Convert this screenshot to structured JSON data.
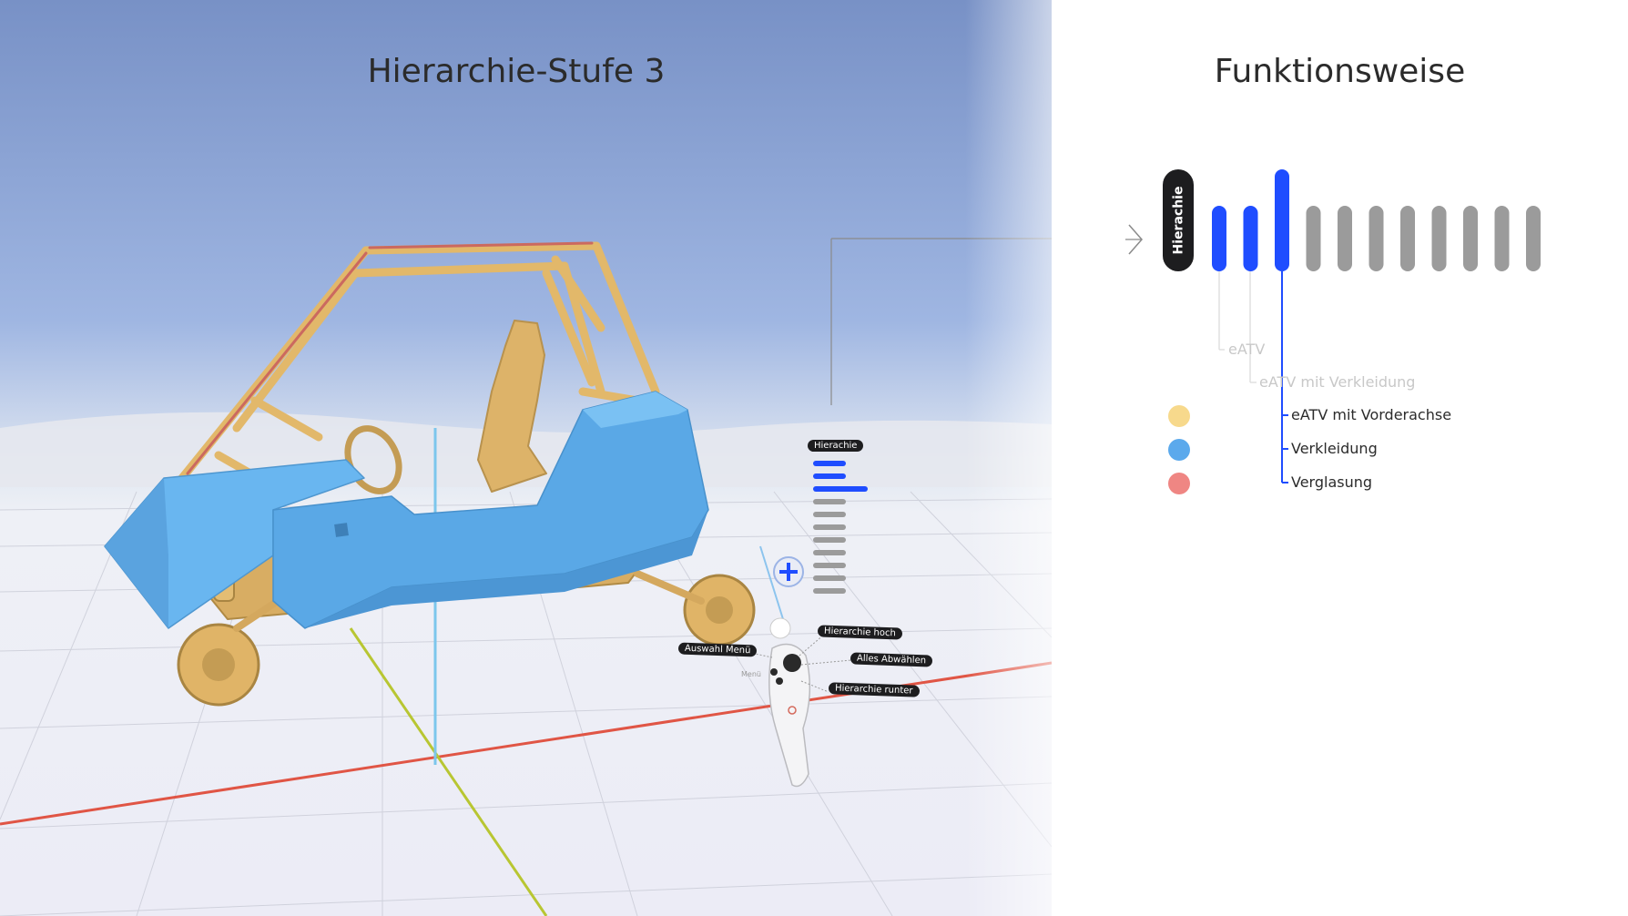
{
  "scene": {
    "title": "Hierarchie-Stufe 3"
  },
  "panel": {
    "title": "Funktionsweise",
    "hierarchy_pill_label": "Hierachie",
    "levels": [
      {
        "level": 1,
        "active": true
      },
      {
        "level": 2,
        "active": true
      },
      {
        "level": 3,
        "active": true,
        "current": true
      },
      {
        "level": 4,
        "active": false
      },
      {
        "level": 5,
        "active": false
      },
      {
        "level": 6,
        "active": false
      },
      {
        "level": 7,
        "active": false
      },
      {
        "level": 8,
        "active": false
      },
      {
        "level": 9,
        "active": false
      },
      {
        "level": 10,
        "active": false
      },
      {
        "level": 11,
        "active": false
      }
    ],
    "tree": [
      {
        "label": "eATV",
        "depth": 1,
        "dimmed": true
      },
      {
        "label": "eATV mit Verkleidung",
        "depth": 2,
        "dimmed": true
      },
      {
        "label": "eATV mit Vorderachse",
        "depth": 3,
        "dimmed": false,
        "color": "#f7d98c"
      },
      {
        "label": "Verkleidung",
        "depth": 3,
        "dimmed": false,
        "color": "#5ba9ec"
      },
      {
        "label": "Verglasung",
        "depth": 3,
        "dimmed": false,
        "color": "#ef8683"
      }
    ]
  },
  "vr_menu": {
    "hierarchy_label": "Hierachie",
    "controller_labels": {
      "hierarchy_up": "Hierarchie hoch",
      "deselect_all": "Alles Abwählen",
      "hierarchy_down": "Hierarchie runter",
      "select_menu": "Auswahl Menü",
      "menu": "Menü"
    },
    "level_count": 11,
    "current_level": 3
  },
  "colors": {
    "accent": "#1f4dff",
    "inactive": "#9b9b9b",
    "frame": "#e2b86a",
    "body": "#5ba9ec"
  }
}
